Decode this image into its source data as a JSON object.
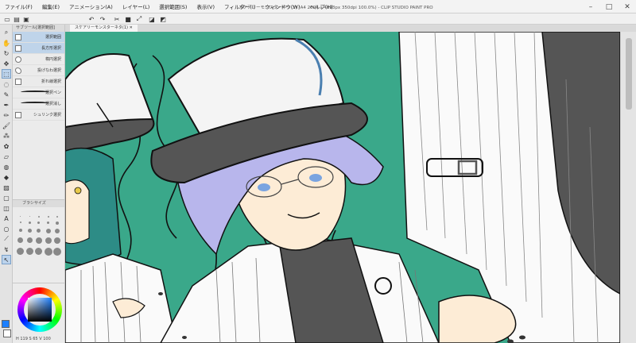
{
  "app": {
    "title": "スケアリーモンスターネタ(1) (A4 2894 x 4093px 350dpi 100.0%) - CLIP STUDIO PAINT PRO"
  },
  "menu": {
    "items": [
      "ファイル(F)",
      "編集(E)",
      "アニメーション(A)",
      "レイヤー(L)",
      "選択範囲(S)",
      "表示(V)",
      "フィルター(I)",
      "ウィンドウ(W)",
      "ヘルプ(H)"
    ]
  },
  "window_controls": {
    "minimize": "–",
    "maximize": "□",
    "close": "✕"
  },
  "subtool_panel": {
    "header": "サブツール[選択範囲]",
    "items": [
      {
        "label": "選択範囲",
        "selected": true
      },
      {
        "label": "長方形選択",
        "selected": true
      },
      {
        "label": "楕円選択",
        "selected": false
      },
      {
        "label": "投げなわ選択",
        "selected": false
      },
      {
        "label": "折れ線選択",
        "selected": false
      },
      {
        "label": "選択ペン",
        "selected": false
      },
      {
        "label": "選択消し",
        "selected": false
      },
      {
        "label": "シュリンク選択",
        "selected": false
      }
    ]
  },
  "brush_panel": {
    "header": "ブラシサイズ"
  },
  "color_panel": {
    "values": "H 119  S 65  V 100"
  },
  "canvas": {
    "tab_label": "スケアリーモンスターネタ(1) ✕"
  },
  "colors": {
    "canvas_bg": "#3aa88a",
    "skin": "#fdecd6",
    "hair": "#b8b6ec",
    "dark": "#555555",
    "white_cloth": "#fafafa",
    "accent_selection": "#bfd4ea"
  },
  "icons": {
    "tools": [
      "zoom-icon",
      "hand-icon",
      "rotate-icon",
      "move-icon",
      "selection-icon",
      "lasso-icon",
      "eyedropper-icon",
      "pen-icon",
      "pencil-icon",
      "brush-icon",
      "airbrush-icon",
      "decoration-icon",
      "eraser-icon",
      "blend-icon",
      "fill-icon",
      "gradient-icon",
      "figure-icon",
      "frame-icon",
      "text-icon",
      "balloon-icon",
      "ruler-icon",
      "correct-line-icon",
      "operation-icon"
    ]
  }
}
